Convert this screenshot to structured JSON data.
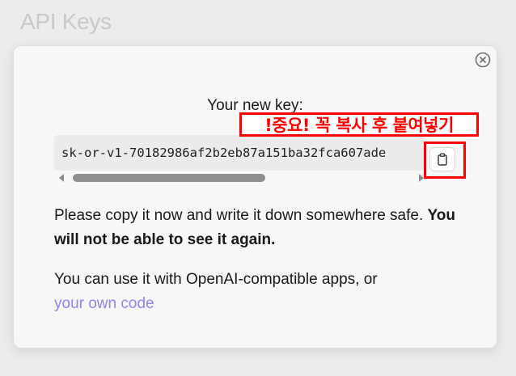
{
  "page": {
    "title": "API Keys"
  },
  "modal": {
    "title": "Your new key:",
    "annotation": "!중요!  꼭 복사 후 붙여넣기",
    "api_key": "sk-or-v1-70182986af2b2eb87a151ba32fca607ade",
    "instructions": {
      "line1": "Please copy it now and write it down somewhere safe.",
      "warning": "You will not be able to see it again."
    },
    "usage": {
      "text": "You can use it with OpenAI-compatible apps, or",
      "link_text": "your own code"
    },
    "icons": {
      "close": "close-circle-icon",
      "copy": "clipboard-icon"
    },
    "colors": {
      "annotation": "#ff0000",
      "link": "#8b88f0",
      "muted_title": "#c9c9c9"
    }
  }
}
